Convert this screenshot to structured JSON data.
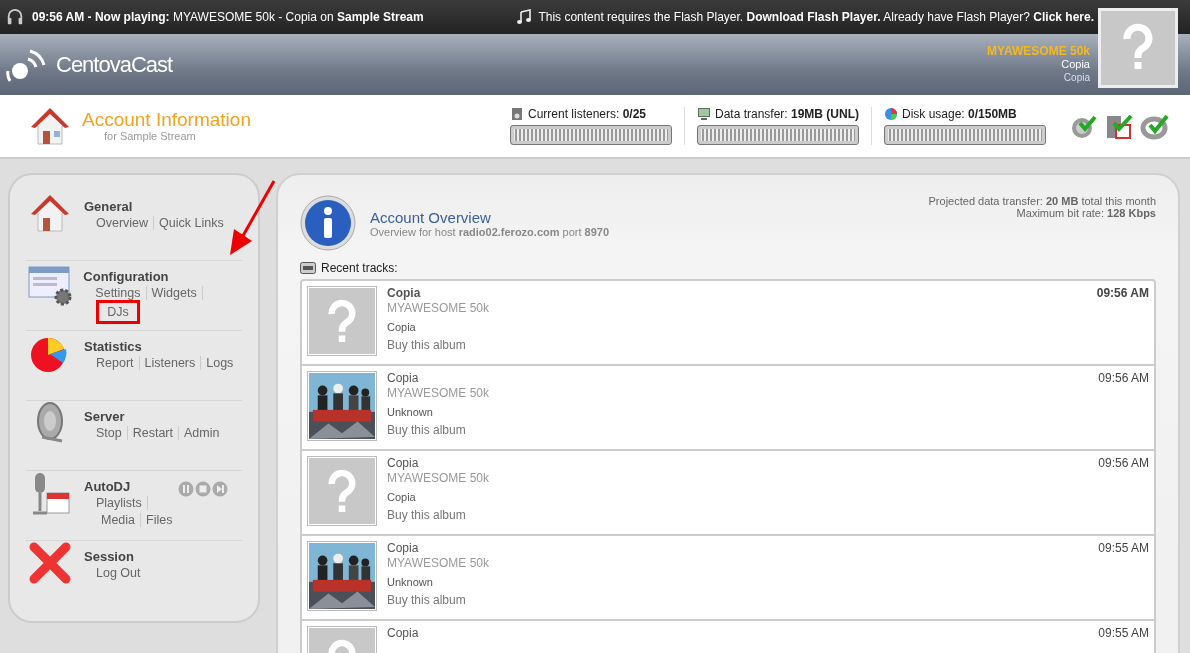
{
  "now_playing": {
    "time": "09:56 AM",
    "prefix": "- Now playing:",
    "track": "MYAWESOME 50k - Copia",
    "on": "on",
    "stream": "Sample Stream"
  },
  "flash_notice": {
    "text": "This content requires the Flash Player.",
    "download": "Download Flash Player.",
    "already": "Already have Flash Player?",
    "click": "Click here."
  },
  "brand": "CentovaCast",
  "current_track": {
    "title": "MYAWESOME 50k",
    "artist": "Copia",
    "album": "Copia"
  },
  "page_title": {
    "title": "Account Information",
    "subtitle": "for Sample Stream"
  },
  "meters": [
    {
      "kind": "listeners",
      "label": "Current listeners:",
      "value": "0/25"
    },
    {
      "kind": "transfer",
      "label": "Data transfer:",
      "value": "19MB (UNL)"
    },
    {
      "kind": "disk",
      "label": "Disk usage:",
      "value": "0/150MB"
    }
  ],
  "sidebar": [
    {
      "kind": "general",
      "title": "General",
      "links": [
        {
          "label": "Overview",
          "highlighted": false
        },
        {
          "label": "Quick Links",
          "highlighted": false
        }
      ]
    },
    {
      "kind": "configuration",
      "title": "Configuration",
      "links": [
        {
          "label": "Settings",
          "highlighted": false
        },
        {
          "label": "Widgets",
          "highlighted": false
        },
        {
          "label": "DJs",
          "highlighted": true
        }
      ]
    },
    {
      "kind": "statistics",
      "title": "Statistics",
      "links": [
        {
          "label": "Report",
          "highlighted": false
        },
        {
          "label": "Listeners",
          "highlighted": false
        },
        {
          "label": "Logs",
          "highlighted": false
        }
      ]
    },
    {
      "kind": "server",
      "title": "Server",
      "links": [
        {
          "label": "Stop",
          "highlighted": false
        },
        {
          "label": "Restart",
          "highlighted": false
        },
        {
          "label": "Admin",
          "highlighted": false
        }
      ]
    },
    {
      "kind": "autodj",
      "title": "AutoDJ",
      "links": [
        {
          "label": "Playlists",
          "highlighted": false
        },
        {
          "label": "Media",
          "highlighted": false
        },
        {
          "label": "Files",
          "highlighted": false
        }
      ]
    },
    {
      "kind": "session",
      "title": "Session",
      "links": [
        {
          "label": "Log Out",
          "highlighted": false
        }
      ]
    }
  ],
  "overview": {
    "title": "Account Overview",
    "subtitle_prefix": "Overview for host",
    "host": "radio02.ferozo.com",
    "port_label": "port",
    "port": "8970",
    "projected_label": "Projected data transfer:",
    "projected_value": "20 MB",
    "projected_suffix": "total this month",
    "bitrate_label": "Maximum bit rate:",
    "bitrate_value": "128 Kbps"
  },
  "recent_tracks": {
    "label": "Recent tracks:",
    "tracks": [
      {
        "kind": "unknown",
        "current": true,
        "title": "Copia",
        "artist": "MYAWESOME 50k",
        "album": "Copia",
        "buy": "Buy this album",
        "time": "09:56 AM"
      },
      {
        "kind": "picture",
        "current": false,
        "title": "Copia",
        "artist": "MYAWESOME 50k",
        "album": "Unknown",
        "buy": "Buy this album",
        "time": "09:56 AM"
      },
      {
        "kind": "unknown",
        "current": false,
        "title": "Copia",
        "artist": "MYAWESOME 50k",
        "album": "Copia",
        "buy": "Buy this album",
        "time": "09:56 AM"
      },
      {
        "kind": "picture",
        "current": false,
        "title": "Copia",
        "artist": "MYAWESOME 50k",
        "album": "Unknown",
        "buy": "Buy this album",
        "time": "09:55 AM"
      },
      {
        "kind": "unknown",
        "current": false,
        "title": "Copia",
        "time": "09:55 AM"
      }
    ]
  }
}
